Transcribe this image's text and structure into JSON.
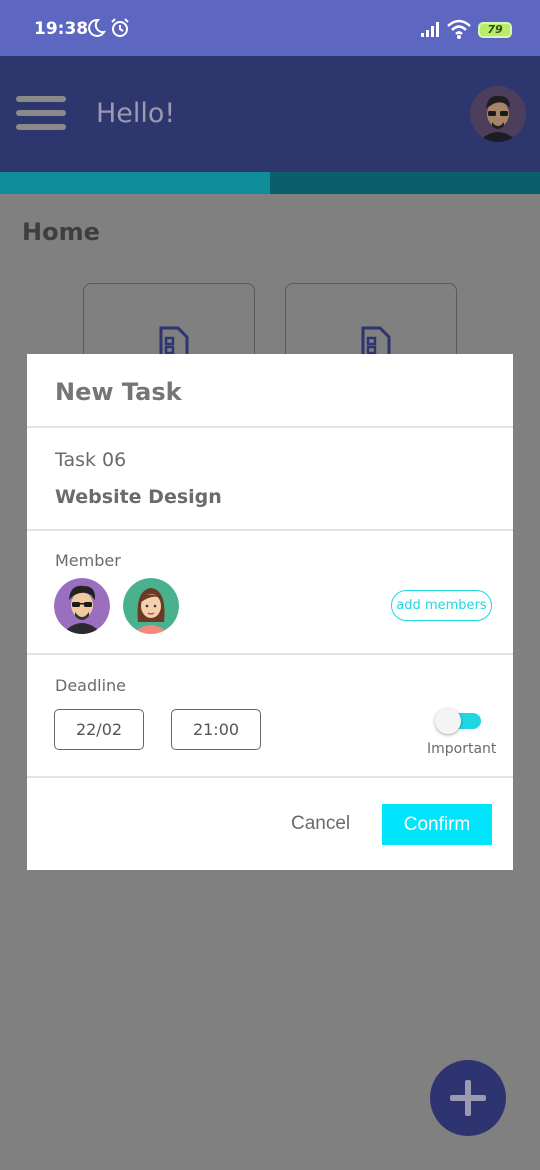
{
  "status_bar": {
    "time": "19:38",
    "battery_level": "79",
    "icons": [
      "moon-icon",
      "alarm-icon",
      "signal-icon",
      "wifi-icon",
      "battery-icon"
    ]
  },
  "header": {
    "greeting": "Hello!",
    "menu_icon": "hamburger-menu-icon",
    "avatar": "user-avatar"
  },
  "progress": {
    "fraction": 0.5
  },
  "home": {
    "title": "Home",
    "cards": [
      {
        "icon": "document-icon"
      },
      {
        "icon": "document-icon"
      }
    ]
  },
  "modal": {
    "title": "New Task",
    "task_number": "Task 06",
    "task_name": "Website Design",
    "member_label": "Member",
    "members": [
      {
        "avatar": "male-avatar"
      },
      {
        "avatar": "female-avatar"
      }
    ],
    "add_members_label": "add members",
    "deadline_label": "Deadline",
    "date_value": "22/02",
    "time_value": "21:00",
    "important_label": "Important",
    "important_on": true,
    "cancel_label": "Cancel",
    "confirm_label": "Confirm"
  },
  "fab": {
    "icon": "plus-icon"
  },
  "colors": {
    "status_bar": "#5d66c0",
    "header": "#2e366e",
    "accent": "#00e5fb",
    "overlay": "#808080"
  }
}
